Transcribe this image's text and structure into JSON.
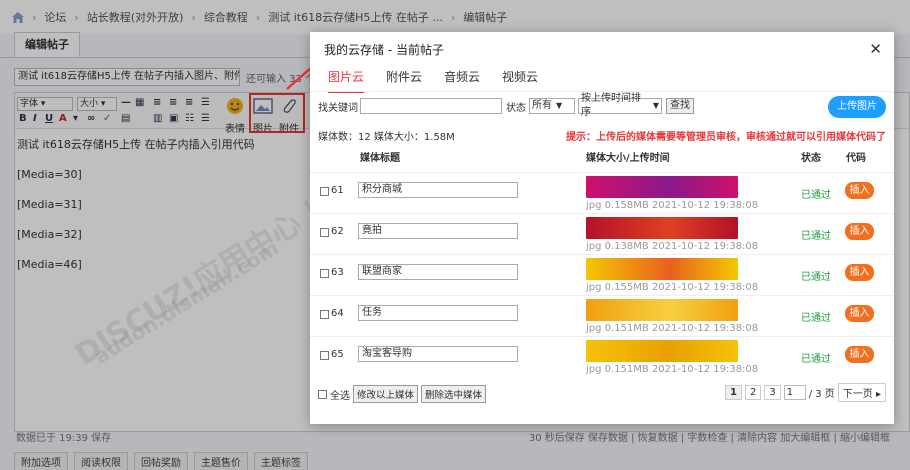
{
  "background": {
    "breadcrumb": [
      "论坛",
      "站长教程(对外开放)",
      "综合教程",
      "测试 it618云存储H5上传 在帖子 ...",
      "编辑帖子"
    ],
    "edit_tab": "编辑帖子",
    "title_value": "测试 it618云存储H5上传 在帖子内插入图片、附件、音频",
    "title_hint": "还可输入 33 个字",
    "toolbar": {
      "font": "字体",
      "size": "大小",
      "emoji": "表情",
      "image": "图片",
      "attach": "附件"
    },
    "editor_lines": [
      "测试 it618云存储H5上传 在帖子内插入引用代码",
      "[Media=30]",
      "[Media=31]",
      "[Media=32]",
      "[Media=46]"
    ],
    "status_left": "数据已于 19:39 保存",
    "status_right": "30 秒后保存 保存数据 | 恢复数据 | 字数检查 | 清除内容  加大编辑框 | 缩小编辑框",
    "bottom_buttons": [
      "附加选项",
      "阅读权限",
      "回帖奖励",
      "主题售价",
      "主题标签"
    ],
    "watermarks": [
      "DISCUZ!应用中心 | 贰道",
      "addon.dismall.com"
    ]
  },
  "dialog": {
    "title": "我的云存储 - 当前帖子",
    "tabs": [
      "图片云",
      "附件云",
      "音频云",
      "视频云"
    ],
    "active_tab": 0,
    "filter": {
      "keyword_label": "找关键词",
      "status_label": "状态",
      "status_value": "所有",
      "sort_value": "按上传时间排序",
      "search_label": "查找"
    },
    "upload_label": "上传图片",
    "count_text": "媒体数：12 媒体大小：1.58M",
    "tip_text": "提示：上传后的媒体需要等管理员审核，审核通过就可以引用媒体代码了",
    "headers": {
      "title": "媒体标题",
      "size": "媒体大小/上传时间",
      "status": "状态",
      "code": "代码"
    },
    "rows": [
      {
        "id": "61",
        "title": "积分商城",
        "meta": "jpg 0.158MB 2021-10-12 19:38:08",
        "status": "已通过",
        "action": "插入",
        "thumb_colors": [
          "#d0106b",
          "#8a1a8a"
        ]
      },
      {
        "id": "62",
        "title": "竟拍",
        "meta": "jpg 0.138MB 2021-10-12 19:38:08",
        "status": "已通过",
        "action": "插入",
        "thumb_colors": [
          "#b3122a",
          "#e04020"
        ]
      },
      {
        "id": "63",
        "title": "联盟商家",
        "meta": "jpg 0.155MB 2021-10-12 19:38:08",
        "status": "已通过",
        "action": "插入",
        "thumb_colors": [
          "#f5c800",
          "#e86020"
        ]
      },
      {
        "id": "64",
        "title": "任务",
        "meta": "jpg 0.151MB 2021-10-12 19:38:08",
        "status": "已通过",
        "action": "插入",
        "thumb_colors": [
          "#f1a010",
          "#f6d040"
        ]
      },
      {
        "id": "65",
        "title": "淘宝客导购",
        "meta": "jpg 0.151MB 2021-10-12 19:38:08",
        "status": "已通过",
        "action": "插入",
        "thumb_colors": [
          "#f6c20a",
          "#e8a000"
        ]
      }
    ],
    "footer": {
      "select_all": "全选",
      "modify": "修改以上媒体",
      "delete": "删除选中媒体"
    },
    "pager": {
      "pages": [
        "1",
        "2",
        "3"
      ],
      "current": "1",
      "input": "1",
      "total": "/ 3 页",
      "next": "下一页 ▸"
    },
    "colors": {
      "accent_red": "#e4393c",
      "upload_blue": "#1e9fff",
      "insert_orange": "#f07020",
      "approved_green": "#1e9e3a"
    }
  }
}
